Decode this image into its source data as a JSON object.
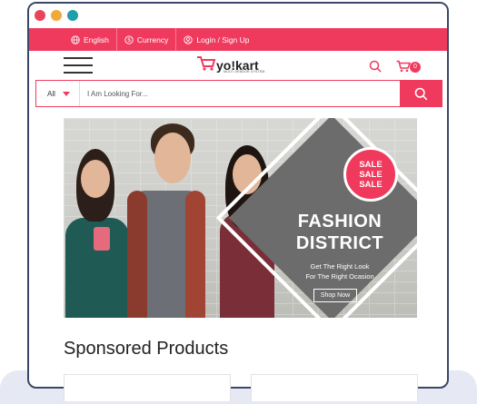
{
  "topbar": {
    "language": "English",
    "currency": "Currency",
    "login": "Login / Sign Up"
  },
  "header": {
    "logo_main": "yo!kart",
    "logo_sub": "MULTI-VENDOR SYSTEM",
    "cart_count": "0"
  },
  "search": {
    "category": "All",
    "placeholder": "I Am Looking For..."
  },
  "banner": {
    "sale_lines": [
      "SALE",
      "SALE",
      "SALE"
    ],
    "title_line1": "FASHION",
    "title_line2": "DISTRICT",
    "subtitle_line1": "Get The Right Look",
    "subtitle_line2": "For The Right Ocasion",
    "cta": "Shop Now"
  },
  "sponsored": {
    "title": "Sponsored Products"
  },
  "colors": {
    "brand": "#ef3a5d",
    "frame": "#3a4766"
  }
}
